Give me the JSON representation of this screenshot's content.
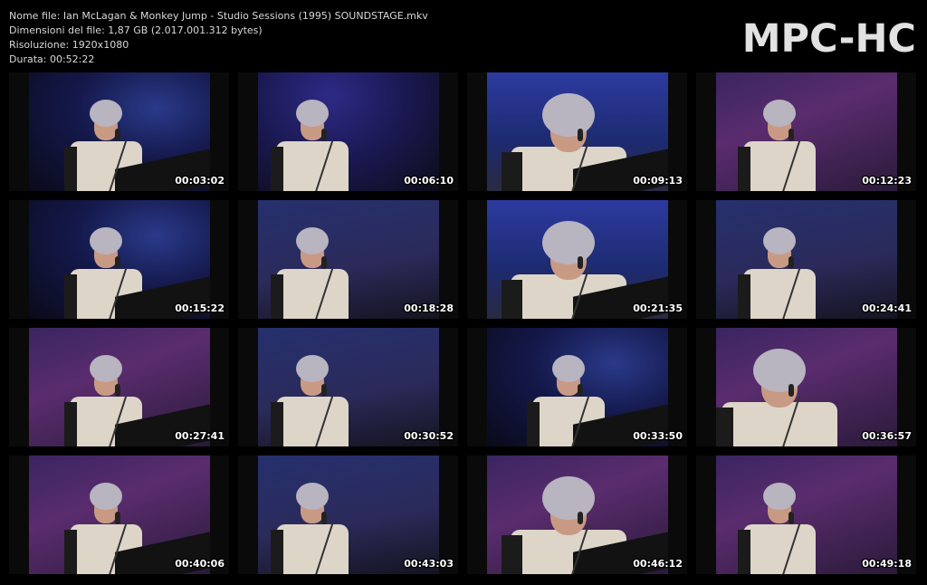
{
  "info": {
    "filename": "Nome file: Ian McLagan & Monkey Jump - Studio Sessions (1995) SOUNDSTAGE.mkv",
    "filesize": "Dimensioni del file: 1,87 GB (2.017.001.312 bytes)",
    "resolution": "Risoluzione: 1920x1080",
    "duration": "Durata: 00:52:22"
  },
  "logo": "MPC-HC",
  "thumbnails": [
    {
      "time": "00:03:02",
      "scene": "scene-a"
    },
    {
      "time": "00:06:10",
      "scene": "scene-b"
    },
    {
      "time": "00:09:13",
      "scene": "scene-c"
    },
    {
      "time": "00:12:23",
      "scene": "scene-d"
    },
    {
      "time": "00:15:22",
      "scene": "scene-a"
    },
    {
      "time": "00:18:28",
      "scene": "scene-e"
    },
    {
      "time": "00:21:35",
      "scene": "scene-c"
    },
    {
      "time": "00:24:41",
      "scene": "scene-e"
    },
    {
      "time": "00:27:41",
      "scene": "scene-d"
    },
    {
      "time": "00:30:52",
      "scene": "scene-e"
    },
    {
      "time": "00:33:50",
      "scene": "scene-a"
    },
    {
      "time": "00:36:57",
      "scene": "scene-d"
    },
    {
      "time": "00:40:06",
      "scene": "scene-d"
    },
    {
      "time": "00:43:03",
      "scene": "scene-e"
    },
    {
      "time": "00:46:12",
      "scene": "scene-d"
    },
    {
      "time": "00:49:18",
      "scene": "scene-d"
    }
  ]
}
